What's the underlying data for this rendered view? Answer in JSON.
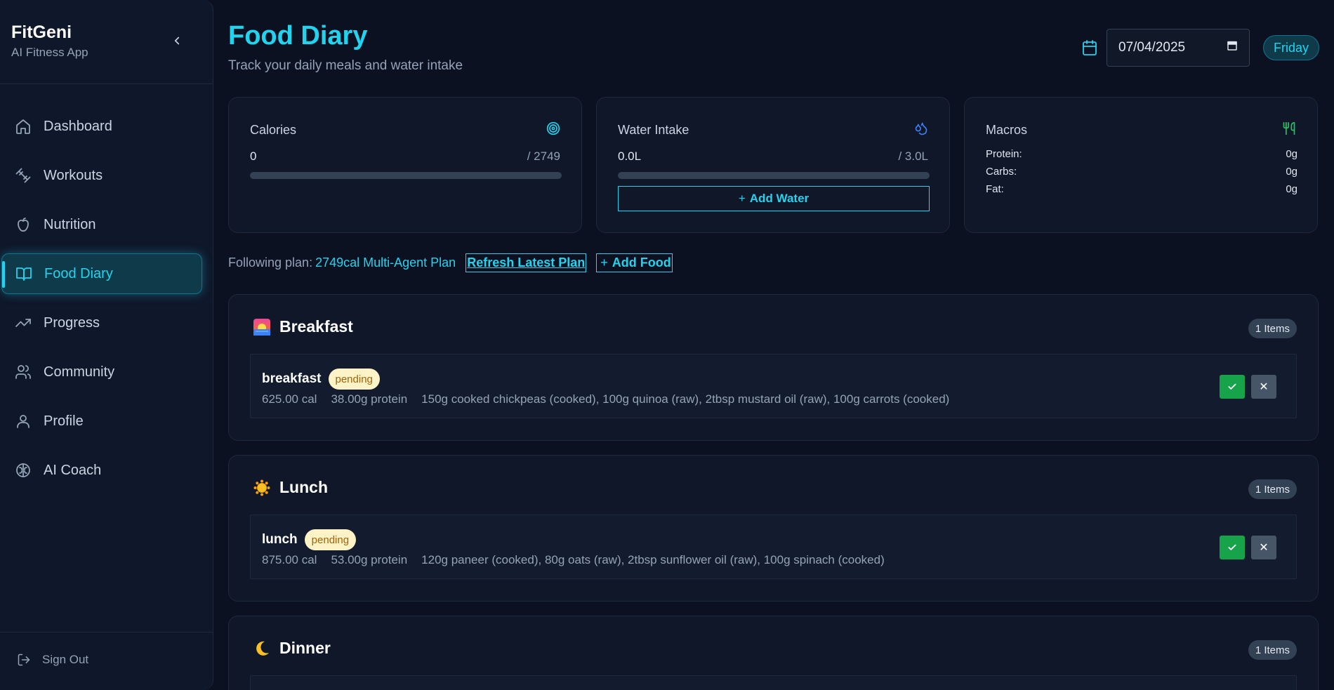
{
  "app": {
    "name": "FitGeni",
    "tagline": "AI Fitness App"
  },
  "sidebar": {
    "items": [
      {
        "label": "Dashboard",
        "icon": "home-icon"
      },
      {
        "label": "Workouts",
        "icon": "dumbbell-icon"
      },
      {
        "label": "Nutrition",
        "icon": "apple-icon"
      },
      {
        "label": "Food Diary",
        "icon": "book-open-icon",
        "active": true
      },
      {
        "label": "Progress",
        "icon": "trending-up-icon"
      },
      {
        "label": "Community",
        "icon": "users-icon"
      },
      {
        "label": "Profile",
        "icon": "user-icon"
      },
      {
        "label": "AI Coach",
        "icon": "brain-icon"
      }
    ],
    "sign_out": "Sign Out"
  },
  "header": {
    "title": "Food Diary",
    "subtitle": "Track your daily meals and water intake",
    "date_value": "07/04/2025",
    "day": "Friday"
  },
  "cards": {
    "calories": {
      "title": "Calories",
      "value": "0",
      "goal": "/ 2749",
      "progress": 0
    },
    "water": {
      "title": "Water Intake",
      "value": "0.0L",
      "goal": "/ 3.0L",
      "progress": 0,
      "add_label": "Add Water"
    },
    "macros": {
      "title": "Macros",
      "rows": [
        {
          "label": "Protein:",
          "value": "0g"
        },
        {
          "label": "Carbs:",
          "value": "0g"
        },
        {
          "label": "Fat:",
          "value": "0g"
        }
      ]
    }
  },
  "plan": {
    "prefix": "Following plan:",
    "name": "2749cal Multi-Agent Plan",
    "refresh_label": "Refresh Latest Plan",
    "add_food_label": "Add Food"
  },
  "meals": [
    {
      "title": "Breakfast",
      "count": "1 Items",
      "entry": {
        "name": "breakfast",
        "status": "pending",
        "calories": "625.00 cal",
        "protein": "38.00g protein",
        "foods": "150g cooked chickpeas (cooked), 100g quinoa (raw), 2tbsp mustard oil (raw), 100g carrots (cooked)"
      }
    },
    {
      "title": "Lunch",
      "count": "1 Items",
      "entry": {
        "name": "lunch",
        "status": "pending",
        "calories": "875.00 cal",
        "protein": "53.00g protein",
        "foods": "120g paneer (cooked), 80g oats (raw), 2tbsp sunflower oil (raw), 100g spinach (cooked)"
      }
    },
    {
      "title": "Dinner",
      "count": "1 Items"
    }
  ],
  "colors": {
    "accent": "#22d3ee",
    "background": "#0b1120",
    "success": "#16a34a",
    "pending_bg": "#fef3c7"
  }
}
